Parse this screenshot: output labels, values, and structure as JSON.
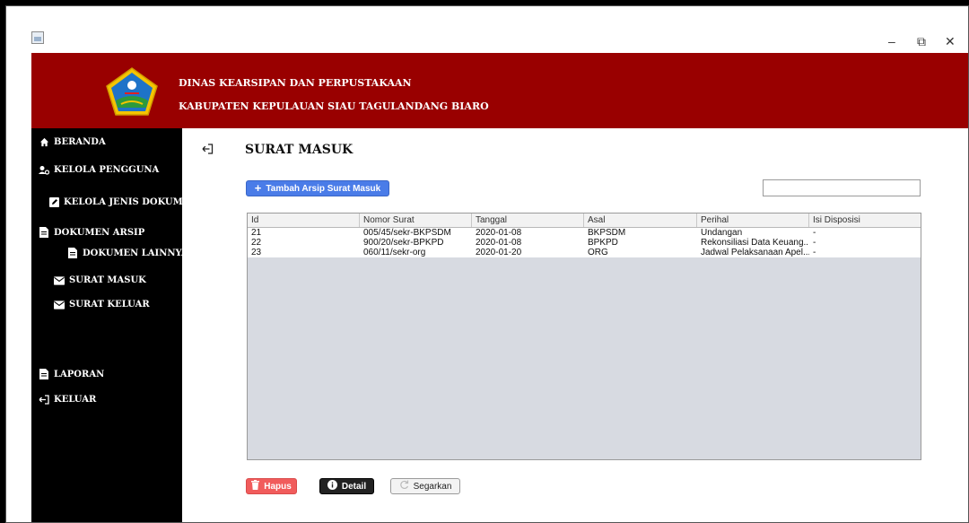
{
  "window": {
    "controls": {
      "minimize": "–",
      "restore": "⧉",
      "close": "✕"
    }
  },
  "header": {
    "line1": "DINAS KEARSIPAN DAN PERPUSTAKAAN",
    "line2": "KABUPATEN KEPULAUAN SIAU TAGULANDANG BIARO",
    "bg_color": "#990000"
  },
  "sidebar": {
    "beranda": "BERANDA",
    "kelola_pengguna": "KELOLA PENGGUNA",
    "kelola_jenis_dokumen": "KELOLA JENIS DOKUMEN",
    "dokumen_arsip": "DOKUMEN ARSIP",
    "dokumen_lainnya": "DOKUMEN LAINNYA",
    "surat_masuk": "SURAT MASUK",
    "surat_keluar": "SURAT KELUAR",
    "laporan": "LAPORAN",
    "keluar": "KELUAR"
  },
  "main": {
    "title": "SURAT MASUK",
    "add_button": "Tambah Arsip Surat Masuk",
    "search_value": "",
    "table": {
      "columns": [
        "Id",
        "Nomor Surat",
        "Tanggal",
        "Asal",
        "Perihal",
        "Isi Disposisi"
      ],
      "rows": [
        [
          "21",
          "005/45/sekr-BKPSDM",
          "2020-01-08",
          "BKPSDM",
          "Undangan",
          "-"
        ],
        [
          "22",
          "900/20/sekr-BPKPD",
          "2020-01-08",
          "BPKPD",
          "Rekonsiliasi Data Keuang...",
          "-"
        ],
        [
          "23",
          "060/11/sekr-org",
          "2020-01-20",
          "ORG",
          "Jadwal Pelaksanaan Apel...",
          "-"
        ]
      ]
    },
    "buttons": {
      "hapus": "Hapus",
      "detail": "Detail",
      "segarkan": "Segarkan"
    }
  }
}
